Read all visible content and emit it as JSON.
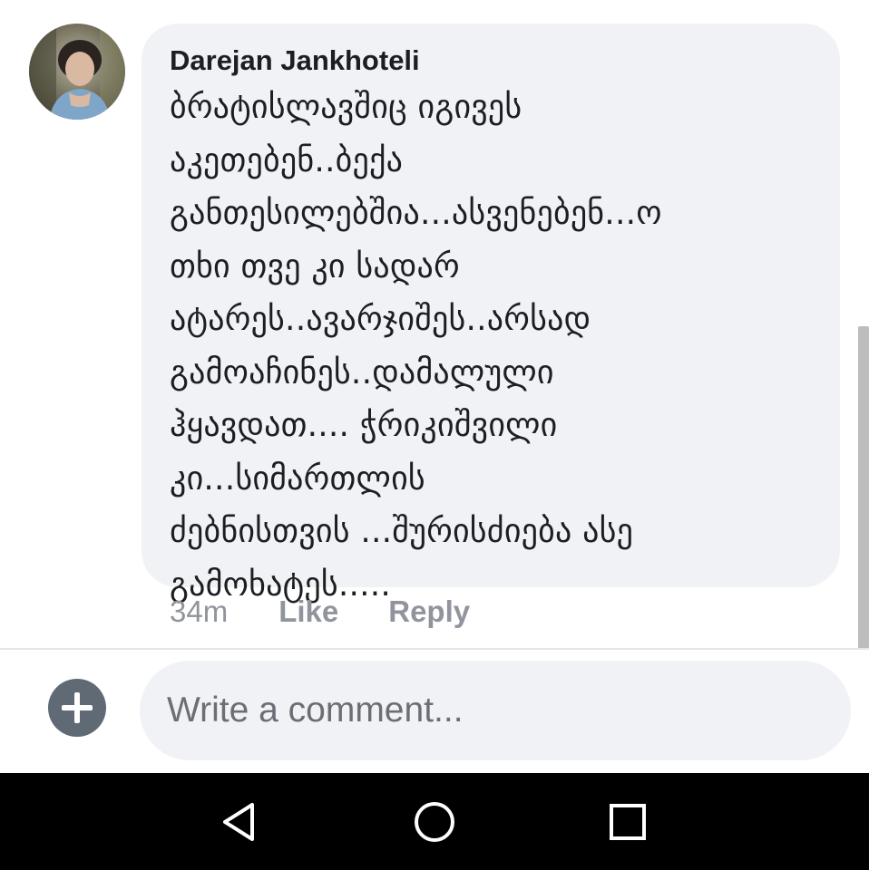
{
  "comment": {
    "author": "Darejan Jankhoteli",
    "text": "ბრატისლავშიც იგივეს\nაკეთებენ..ბექა\nგანთესილებშია...ასვენებენ...ო\nთხი თვე კი სადარ\nატარეს..ავარჯიშეს..არსად\nგამოაჩინეს..დამალული\nჰყავდათ.... ჭრიკიშვილი\nკი...სიმართლის\nძებნისთვის ...შურისძიება ასე\nგამოხატეს.....",
    "time": "34m",
    "like_label": "Like",
    "reply_label": "Reply",
    "avatar_icon": "user-avatar"
  },
  "composer": {
    "placeholder": "Write a comment...",
    "value": "",
    "add_icon": "plus-icon"
  },
  "navigation": {
    "back_icon": "back-triangle-icon",
    "home_icon": "home-circle-icon",
    "recents_icon": "recents-square-icon"
  },
  "colors": {
    "bubble": "#f0f2f5",
    "text": "#1c1e21",
    "meta": "#90949c",
    "nav_bar": "#000000",
    "add_button": "#5f6a74"
  }
}
